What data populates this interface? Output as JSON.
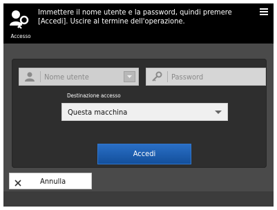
{
  "header": {
    "login_caption": "Accesso",
    "instruction": "Immettere il nome utente e la password, quindi premere [Accedi]. Uscire al termine dell'operazione."
  },
  "form": {
    "username_placeholder": "Nome utente",
    "password_placeholder": "Password",
    "destination_label": "Destinazione accesso",
    "destination_value": "Questa macchina",
    "login_button": "Accedi"
  },
  "actions": {
    "cancel_label": "Annulla"
  },
  "colors": {
    "primary_button": "#1a5fb4",
    "background": "#4a4a4a",
    "header": "#000000"
  }
}
